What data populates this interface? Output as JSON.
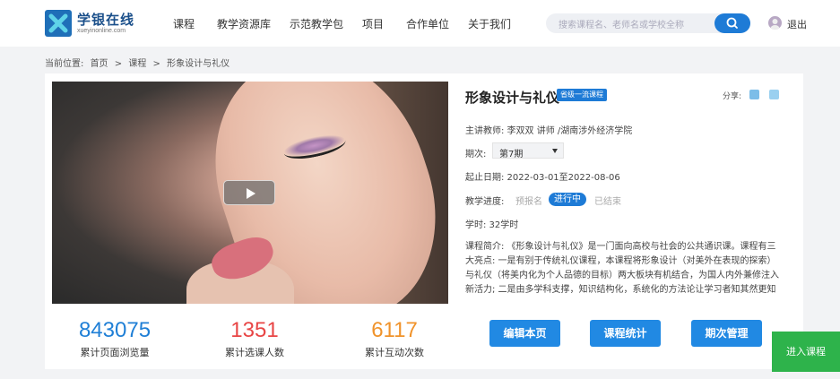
{
  "header": {
    "brand": "学银在线",
    "brand_sub": "xueyinonline.com",
    "nav": [
      "课程",
      "教学资源库",
      "示范教学包",
      "项目",
      "合作单位",
      "关于我们"
    ],
    "search_placeholder": "搜索课程名、老师名或学校全称",
    "logout": "退出"
  },
  "breadcrumb": {
    "label": "当前位置:",
    "items": [
      "首页",
      ">",
      "课程",
      ">",
      "形象设计与礼仪"
    ]
  },
  "course": {
    "title": "形象设计与礼仪",
    "badge": "省级一流课程",
    "share_label": "分享:",
    "teacher": "主讲教师: 李双双 讲师 /湖南涉外经济学院",
    "term_label": "期次:",
    "term_value": "第7期",
    "dates": "起止日期: 2022-03-01至2022-08-06",
    "progress_label": "教学进度:",
    "progress_states": [
      "预报名",
      "进行中",
      "已结束"
    ],
    "hours": "学时: 32学时",
    "intro": "课程简介: 《形象设计与礼仪》是一门面向高校与社会的公共通识课。课程有三大亮点: 一是有别于传统礼仪课程，本课程将形象设计（对美外在表现的探索）与礼仪（将美内化为个人品德的目标）两大板块有机结合，为国人内外兼修注入新活力; 二是由多学科支撑，知识结构化，系统化的方法论让学习者知其然更知其所以然; 三是课..."
  },
  "stats": [
    {
      "value": "843075",
      "label": "累计页面浏览量",
      "color": "#1f7fd6"
    },
    {
      "value": "1351",
      "label": "累计选课人数",
      "color": "#e84545"
    },
    {
      "value": "6117",
      "label": "累计互动次数",
      "color": "#f0932b"
    }
  ],
  "actions": [
    "编辑本页",
    "课程统计",
    "期次管理"
  ],
  "enter_button": "进入课程"
}
